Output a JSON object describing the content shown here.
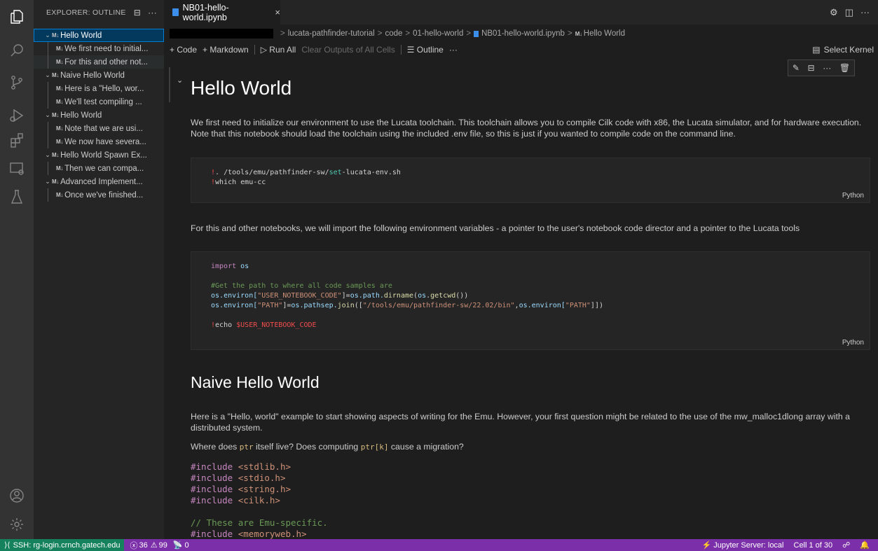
{
  "sidebar": {
    "title": "EXPLORER: OUTLINE",
    "outline": [
      {
        "label": "Hello World",
        "level": 0,
        "expandable": true
      },
      {
        "label": "We first need to initial...",
        "level": 1
      },
      {
        "label": "For this and other not...",
        "level": 1
      },
      {
        "label": "Naive Hello World",
        "level": 0,
        "expandable": true
      },
      {
        "label": "Here is a \"Hello, wor...",
        "level": 1
      },
      {
        "label": "We'll test compiling ...",
        "level": 1
      },
      {
        "label": "Hello World",
        "level": 0,
        "expandable": true
      },
      {
        "label": "Note that we are usi...",
        "level": 1
      },
      {
        "label": "We now have severa...",
        "level": 1
      },
      {
        "label": "Hello World Spawn Ex...",
        "level": 0,
        "expandable": true
      },
      {
        "label": "Then we can compa...",
        "level": 1
      },
      {
        "label": "Advanced Implement...",
        "level": 0,
        "expandable": true
      },
      {
        "label": "Once we've finished...",
        "level": 1
      }
    ],
    "md_badge": "M↓"
  },
  "tab": {
    "title": "NB01-hello-world.ipynb",
    "close": "×"
  },
  "breadcrumb": {
    "items": [
      "lucata-pathfinder-tutorial",
      "code",
      "01-hello-world",
      "NB01-hello-world.ipynb",
      "Hello World"
    ],
    "sep": ">"
  },
  "toolbar": {
    "code": "+ Code",
    "markdown": "+ Markdown",
    "run_all": "▷ Run All",
    "clear": "Clear Outputs of All Cells",
    "outline": "☰ Outline",
    "more": "···",
    "select_kernel": "Select Kernel"
  },
  "notebook": {
    "h1": "Hello World",
    "p1": "We first need to initialize our environment to use the Lucata toolchain. This toolchain allows you to compile Cilk code with x86, the Lucata simulator, and for hardware execution. Note that this notebook should load the toolchain using the included .env file, so this is just if you wanted to compile code on the command line.",
    "p2": "For this and other notebooks, we will import the following environment variables - a pointer to the user's notebook code director and a pointer to the Lucata tools",
    "h2": "Naive Hello World",
    "p3": "Here is a \"Hello, world\" example to start showing aspects of writing for the Emu. However, your first question might be related to the use of the mw_malloc1dlong array with a distributed system.",
    "p4_a": "Where does ",
    "p4_code1": "ptr",
    "p4_b": " itself live? Does computing ",
    "p4_code2": "ptr[k]",
    "p4_c": " cause a migration?",
    "cell_lang": "Python",
    "c_include": "#include",
    "headers": [
      "<stdlib.h>",
      "<stdio.h>",
      "<string.h>",
      "<cilk.h>"
    ],
    "comment": "// These are Emu-specific.",
    "header_last": "<memoryweb.h>"
  },
  "code1": {
    "l1_bang": "!",
    "l1_a": ". /tools/emu/pathfinder-sw/",
    "l1_set": "set",
    "l1_b": "-lucata-env.sh",
    "l2_bang": "!",
    "l2_rest": "which emu-cc"
  },
  "code2": {
    "import": "import",
    "os": "os",
    "comment": "#Get the path to where all code samples are",
    "l3_a": "os",
    "l3_b": ".environ[",
    "l3_str": "\"USER_NOTEBOOK_CODE\"",
    "l3_c": "]=",
    "l3_d": "os",
    "l3_e": ".path.",
    "l3_fn": "dirname",
    "l3_f": "(",
    "l3_g": "os",
    "l3_h": ".",
    "l3_fn2": "getcwd",
    "l3_i": "())",
    "l4_a": "os",
    "l4_b": ".environ[",
    "l4_str": "\"PATH\"",
    "l4_c": "]=",
    "l4_d": "os",
    "l4_e": ".pathsep.",
    "l4_fn": "join",
    "l4_f": "([",
    "l4_str2": "\"/tools/emu/pathfinder-sw/22.02/bin\"",
    "l4_g": ",",
    "l4_h": "os",
    "l4_i": ".environ[",
    "l4_str3": "\"PATH\"",
    "l4_j": "]])",
    "l5_bang": "!",
    "l5_a": "echo ",
    "l5_env": "$USER_NOTEBOOK_CODE"
  },
  "status": {
    "remote": "SSH: rg-login.crnch.gatech.edu",
    "errors": "36",
    "warnings": "99",
    "ports": "0",
    "jupyter": "Jupyter Server: local",
    "cell": "Cell 1 of 30"
  },
  "colors": {
    "statusbar": "#7b2fa8",
    "remote": "#16825d",
    "accent": "#007fd4"
  }
}
